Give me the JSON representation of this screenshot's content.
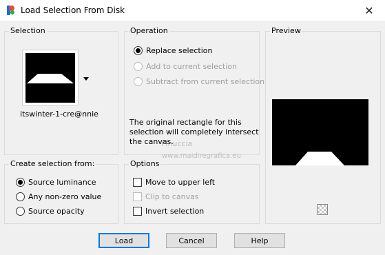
{
  "window": {
    "title": "Load Selection From Disk",
    "close_label": "✕"
  },
  "selection_group": {
    "label": "Selection",
    "file_name": "itswinter-1-cre@nnie"
  },
  "operation_group": {
    "label": "Operation",
    "options": [
      {
        "label": "Replace selection",
        "checked": true,
        "enabled": true
      },
      {
        "label": "Add to current selection",
        "checked": false,
        "enabled": false
      },
      {
        "label": "Subtract from current selection",
        "checked": false,
        "enabled": false
      }
    ],
    "info_text": "The original rectangle for this selection will completely intersect the canvas."
  },
  "preview_group": {
    "label": "Preview"
  },
  "create_group": {
    "label": "Create selection from:",
    "options": [
      {
        "label": "Source luminance",
        "checked": true
      },
      {
        "label": "Any non-zero value",
        "checked": false
      },
      {
        "label": "Source opacity",
        "checked": false
      }
    ]
  },
  "options_group": {
    "label": "Options",
    "items": [
      {
        "label": "Move to upper left",
        "checked": false,
        "enabled": true
      },
      {
        "label": "Clip to canvas",
        "checked": false,
        "enabled": false
      },
      {
        "label": "Invert selection",
        "checked": false,
        "enabled": true
      }
    ]
  },
  "buttons": {
    "load": "Load",
    "cancel": "Cancel",
    "help": "Help"
  },
  "watermark": {
    "line1": "Pinuccia",
    "line2": "www.maidiregrafica.eu"
  },
  "colors": {
    "accent": "#0078d7",
    "canvas": "#000000",
    "shape": "#ffffff"
  }
}
